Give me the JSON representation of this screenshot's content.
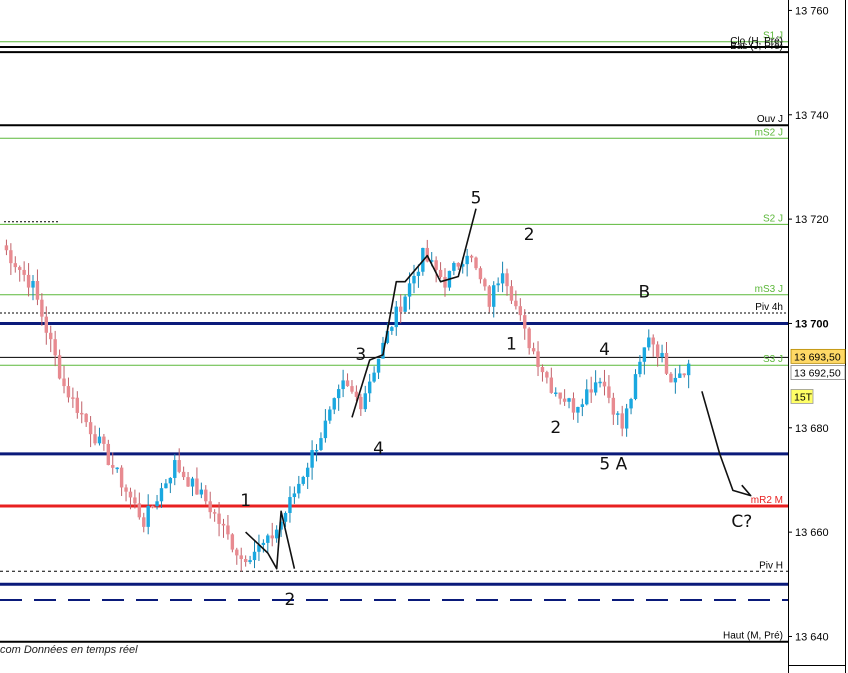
{
  "chart_data": {
    "type": "candlestick",
    "ylim": [
      13633,
      13762
    ],
    "yticks": [
      {
        "v": 13760,
        "label": "13 760",
        "bold": false
      },
      {
        "v": 13740,
        "label": "13 740",
        "bold": false
      },
      {
        "v": 13720,
        "label": "13 720",
        "bold": false
      },
      {
        "v": 13700,
        "label": "13 700",
        "bold": true
      },
      {
        "v": 13680,
        "label": "13 680",
        "bold": false
      },
      {
        "v": 13660,
        "label": "13 660",
        "bold": false
      },
      {
        "v": 13640,
        "label": "13 640",
        "bold": false
      }
    ],
    "price_tags": [
      {
        "v": 13693.5,
        "label": "13 693,50",
        "style": "highlight"
      },
      {
        "v": 13692.5,
        "label": "13 692,50",
        "style": "plain"
      },
      {
        "v": 13688.5,
        "label": "15T",
        "style": "yellow"
      }
    ],
    "levels": [
      {
        "v": 13754,
        "label": "S1 J",
        "color": "#5cb83a",
        "width": 1,
        "dash": ""
      },
      {
        "v": 13753,
        "label": "Clo (H, Pré)",
        "color": "#000000",
        "width": 2,
        "dash": ""
      },
      {
        "v": 13752,
        "label": "Bas (J, Pré)",
        "color": "#000000",
        "width": 2,
        "dash": ""
      },
      {
        "v": 13738,
        "label": "Ouv J",
        "color": "#000000",
        "width": 2,
        "dash": ""
      },
      {
        "v": 13735.5,
        "label": "mS2 J",
        "color": "#5cb83a",
        "width": 1,
        "dash": ""
      },
      {
        "v": 13719,
        "label": "S2 J",
        "color": "#5cb83a",
        "width": 1,
        "dash": ""
      },
      {
        "v": 13705.5,
        "label": "mS3 J",
        "color": "#5cb83a",
        "width": 1,
        "dash": ""
      },
      {
        "v": 13702,
        "label": "Piv 4h",
        "color": "#000000",
        "width": 1,
        "dash": "2,2"
      },
      {
        "v": 13700,
        "label": "",
        "color": "#0a1a7a",
        "width": 3,
        "dash": ""
      },
      {
        "v": 13693.5,
        "label": "",
        "color": "#000000",
        "width": 1,
        "dash": ""
      },
      {
        "v": 13692,
        "label": "S3 J",
        "color": "#5cb83a",
        "width": 1,
        "dash": ""
      },
      {
        "v": 13675,
        "label": "",
        "color": "#0a1a7a",
        "width": 3,
        "dash": ""
      },
      {
        "v": 13665,
        "label": "mR2 M",
        "color": "#e82020",
        "width": 3,
        "dash": ""
      },
      {
        "v": 13652.5,
        "label": "Piv H",
        "color": "#000000",
        "width": 1,
        "dash": "3,3"
      },
      {
        "v": 13650,
        "label": "",
        "color": "#0a1a7a",
        "width": 3,
        "dash": ""
      },
      {
        "v": 13647,
        "label": "",
        "color": "#0a1a7a",
        "width": 2,
        "dash": "22,12"
      },
      {
        "v": 13639,
        "label": "Haut (M, Pré)",
        "color": "#000000",
        "width": 2,
        "dash": ""
      }
    ],
    "waypoints": [
      [
        0,
        13715
      ],
      [
        7,
        13707
      ],
      [
        14,
        13688
      ],
      [
        22,
        13677
      ],
      [
        32,
        13662
      ],
      [
        39,
        13673
      ],
      [
        46,
        13666
      ],
      [
        54,
        13655
      ],
      [
        60,
        13658
      ],
      [
        63,
        13662
      ],
      [
        70,
        13675
      ],
      [
        77,
        13688
      ],
      [
        81,
        13685
      ],
      [
        88,
        13700
      ],
      [
        95,
        13713
      ],
      [
        100,
        13708
      ],
      [
        105,
        13714
      ],
      [
        110,
        13704
      ],
      [
        113,
        13711
      ],
      [
        118,
        13698
      ],
      [
        124,
        13688
      ],
      [
        129,
        13684
      ],
      [
        135,
        13690
      ],
      [
        140,
        13680
      ],
      [
        146,
        13698
      ],
      [
        151,
        13690
      ],
      [
        155,
        13692
      ]
    ],
    "annotations": [
      {
        "text": "5",
        "v": 13723,
        "i": 107
      },
      {
        "text": "2",
        "v": 13716,
        "i": 119
      },
      {
        "text": "B",
        "v": 13705,
        "i": 145
      },
      {
        "text": "3",
        "v": 13693,
        "i": 81
      },
      {
        "text": "1",
        "v": 13695,
        "i": 115
      },
      {
        "text": "4",
        "v": 13694,
        "i": 136
      },
      {
        "text": "4",
        "v": 13675,
        "i": 85
      },
      {
        "text": "2",
        "v": 13679,
        "i": 125
      },
      {
        "text": "5 A",
        "v": 13672,
        "i": 138
      },
      {
        "text": "1",
        "v": 13665,
        "i": 55
      },
      {
        "text": "2",
        "v": 13646,
        "i": 65
      },
      {
        "text": "C?",
        "v": 13661,
        "i": 167
      }
    ],
    "source": "com  Données en temps réel"
  }
}
